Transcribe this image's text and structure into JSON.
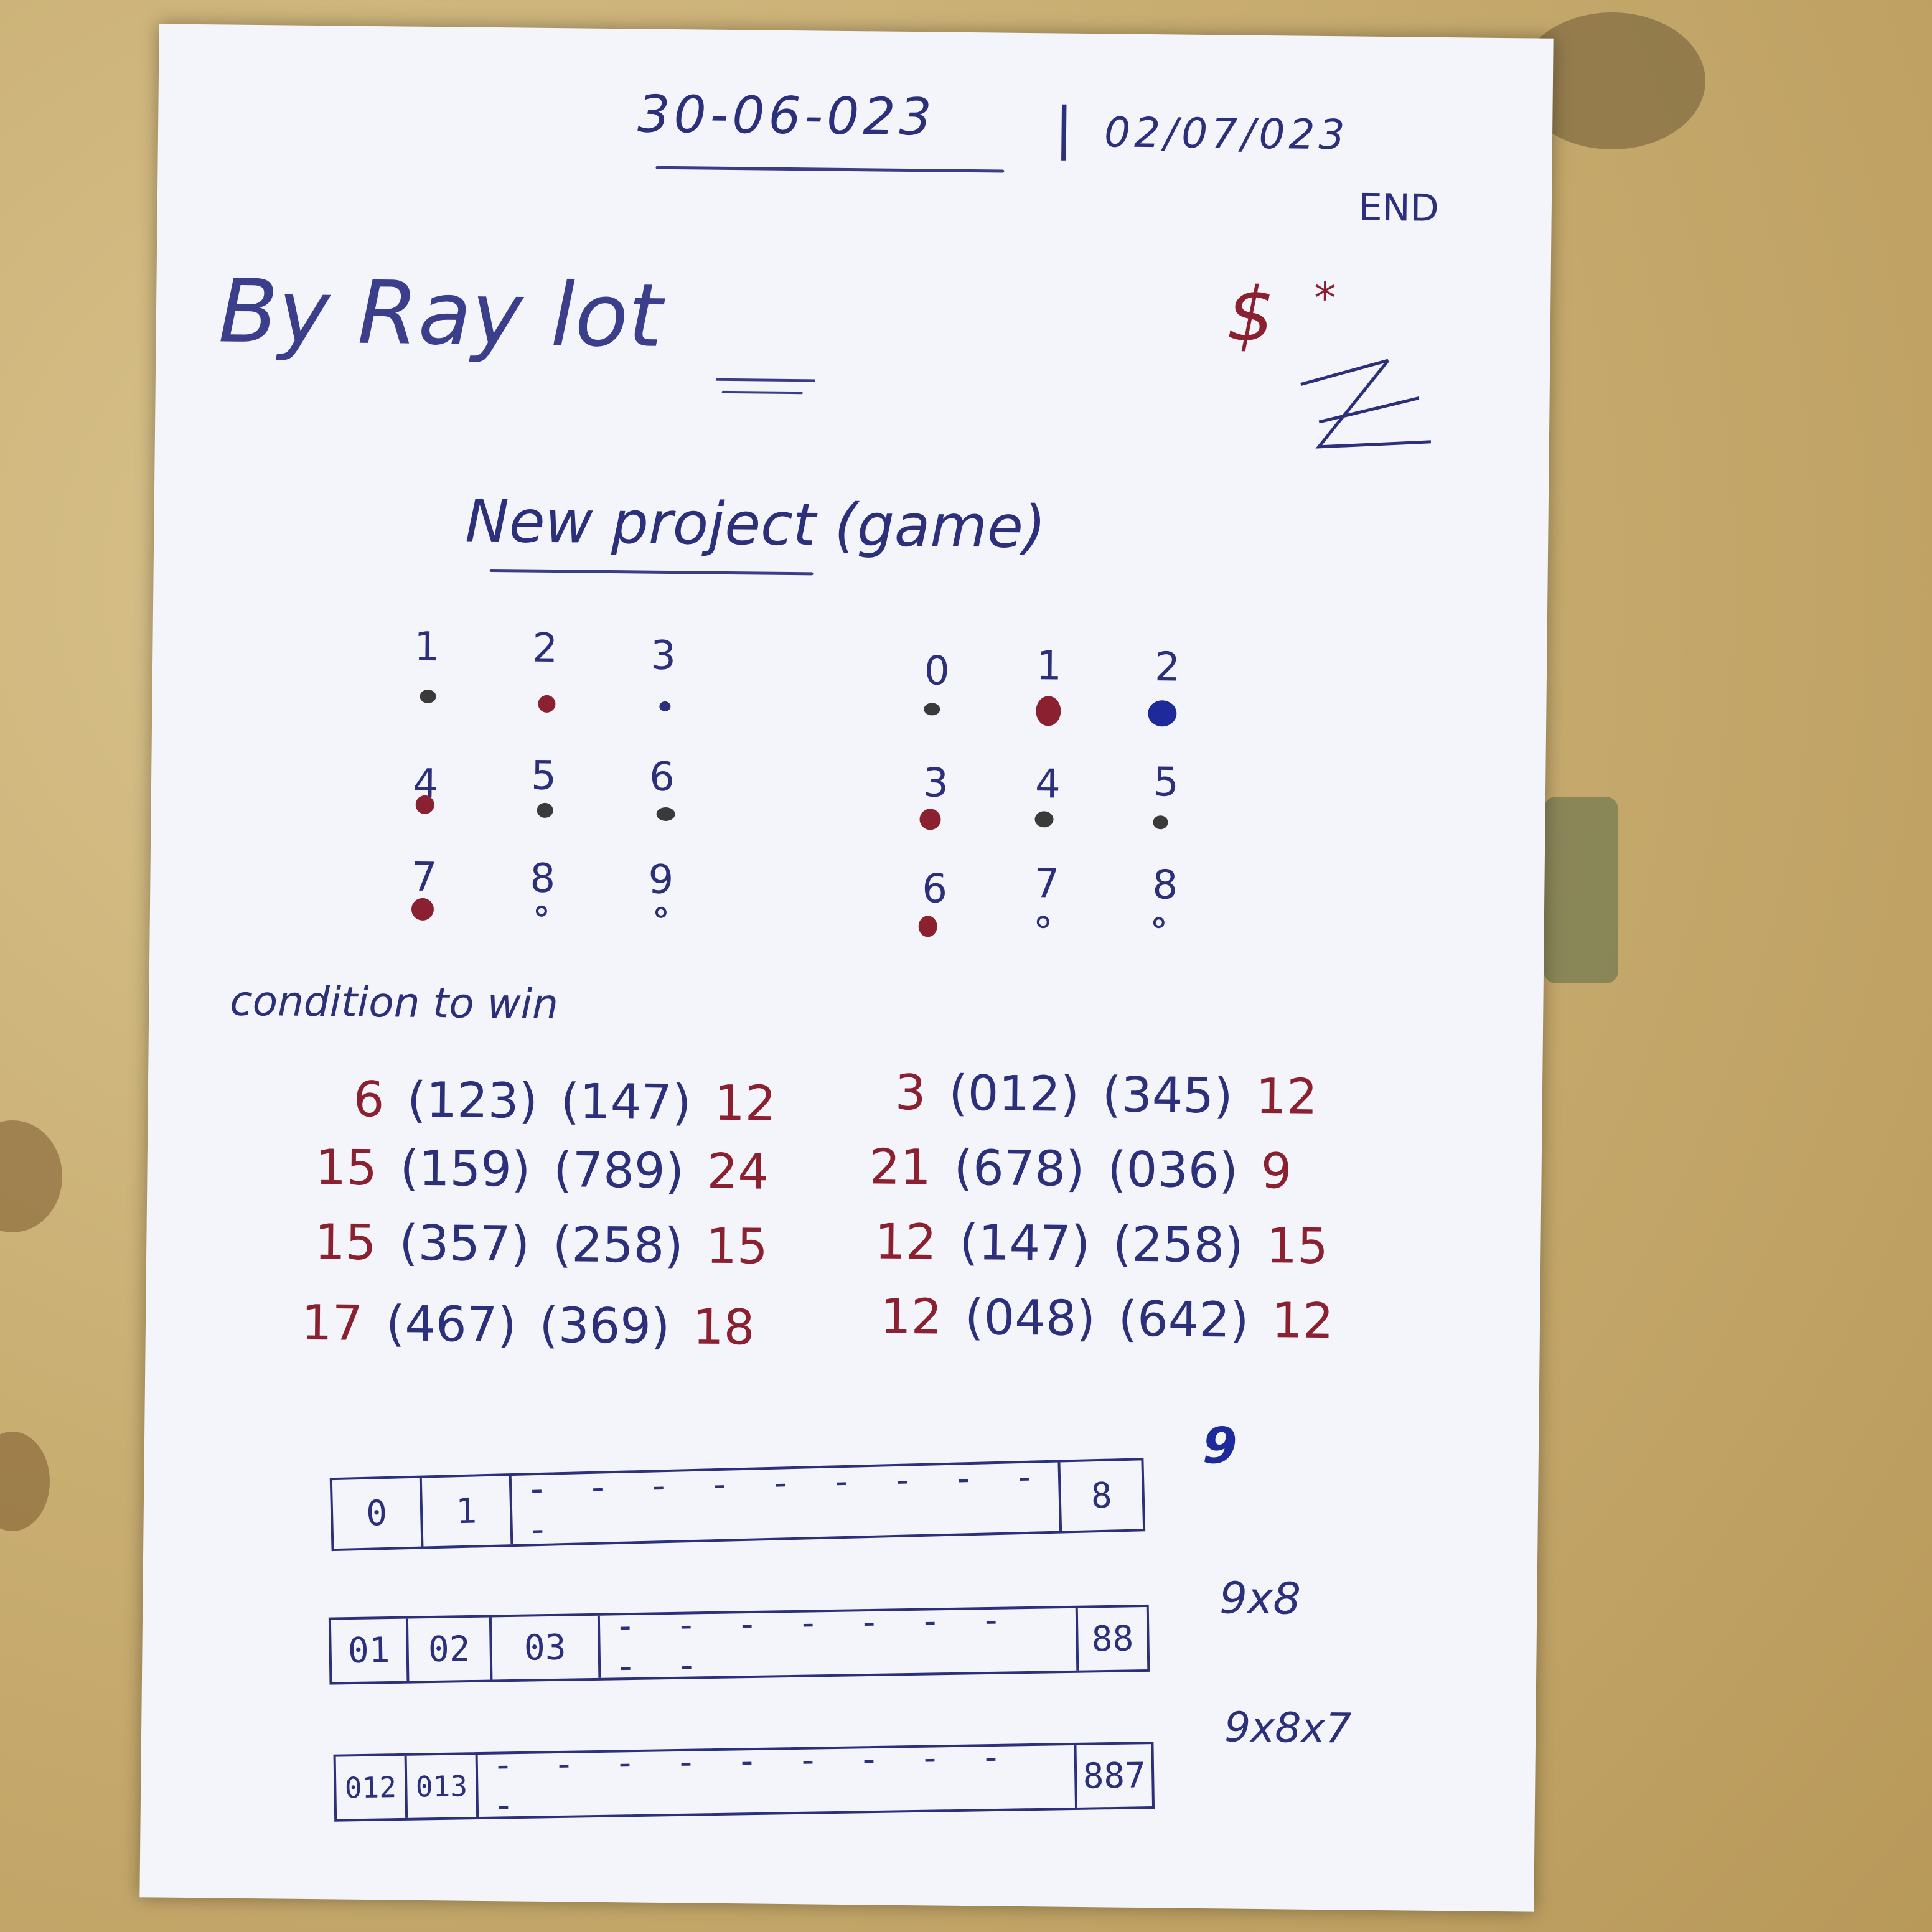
{
  "header": {
    "date_start": "30-06-023",
    "date_end": "02/07/023",
    "end_label": "END"
  },
  "author": {
    "line": "By Ray lot",
    "mark_dollar": "$",
    "mark_star": "*"
  },
  "title": "New project (game)",
  "grid_left": {
    "numbers": [
      "1",
      "2",
      "3",
      "4",
      "5",
      "6",
      "7",
      "8",
      "9"
    ],
    "dot_colors": [
      "#3a3a3a",
      "#8a2030",
      "#2c2f7a",
      "#8a2030",
      "#3a3a3a",
      "#3a3a3a",
      "#8a2030",
      "hollow",
      "hollow"
    ]
  },
  "grid_right": {
    "numbers": [
      "0",
      "1",
      "2",
      "3",
      "4",
      "5",
      "6",
      "7",
      "8"
    ],
    "dot_colors": [
      "#3a3a3a",
      "#8a2030",
      "#1e2a9a",
      "#8a2030",
      "#3a3a3a",
      "#3a3a3a",
      "#8a2030",
      "hollow",
      "hollow"
    ]
  },
  "section_label": "condition to win",
  "left_combos": [
    {
      "lead": "6",
      "a": "(123)",
      "b": "(147)",
      "tail": "12"
    },
    {
      "lead": "15",
      "a": "(159)",
      "b": "(789)",
      "tail": "24"
    },
    {
      "lead": "15",
      "a": "(357)",
      "b": "(258)",
      "tail": "15"
    },
    {
      "lead": "17",
      "a": "(467)",
      "b": "(369)",
      "tail": "18"
    }
  ],
  "right_combos": [
    {
      "lead": "3",
      "a": "(012)",
      "b": "(345)",
      "tail": "12"
    },
    {
      "lead": "21",
      "a": "(678)",
      "b": "(036)",
      "tail": "9"
    },
    {
      "lead": "12",
      "a": "(147)",
      "b": "(258)",
      "tail": "15"
    },
    {
      "lead": "12",
      "a": "(048)",
      "b": "(642)",
      "tail": "12"
    }
  ],
  "strips": [
    {
      "cells": [
        "0",
        "1"
      ],
      "dashes": "- - - - - - - - - -",
      "last": "8",
      "note": "9"
    },
    {
      "cells": [
        "01",
        "02",
        "03"
      ],
      "dashes": "- - - - - - - - -",
      "last": "88",
      "note": "9x8"
    },
    {
      "cells": [
        "012",
        "013"
      ],
      "dashes": "- - - - - - - - - -",
      "last": "887",
      "note": "9x8x7"
    }
  ]
}
